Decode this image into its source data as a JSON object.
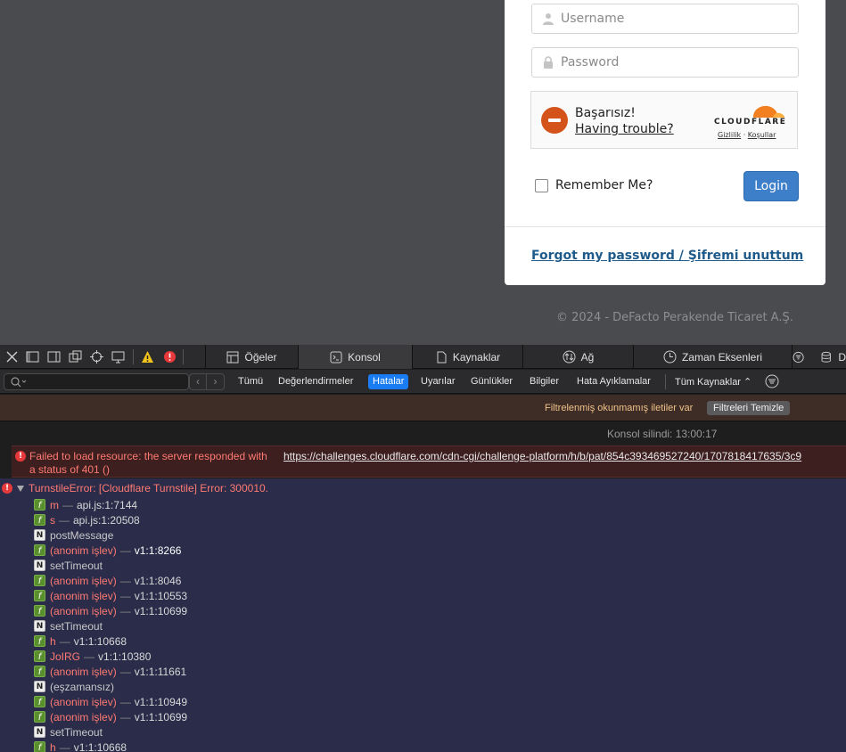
{
  "login": {
    "username_placeholder": "Username",
    "password_placeholder": "Password",
    "turnstile": {
      "status": "Başarısız!",
      "help": "Having trouble?",
      "brand": "CLOUDFLARE",
      "privacy": "Gizlilik",
      "dot": "·",
      "terms": "Koşullar"
    },
    "remember_label": "Remember Me?",
    "login_button": "Login",
    "forgot_link": "Forgot my password / Şifremi unuttum"
  },
  "footer": {
    "copyright": "© 2024 - DeFacto Perakende Ticaret A.Ş."
  },
  "devtools": {
    "tabs": [
      {
        "label": "Öğeler",
        "icon": "elements-icon"
      },
      {
        "label": "Konsol",
        "icon": "console-icon"
      },
      {
        "label": "Kaynaklar",
        "icon": "sources-icon"
      },
      {
        "label": "Ağ",
        "icon": "network-icon"
      },
      {
        "label": "Zaman Eksenleri",
        "icon": "timelines-icon"
      },
      {
        "label": "D",
        "icon": "storage-icon"
      }
    ],
    "active_tab": "Konsol",
    "filters": [
      "Tümü",
      "Değerlendirmeler",
      "Hatalar",
      "Uyarılar",
      "Günlükler",
      "Bilgiler",
      "Hata Ayıklamalar"
    ],
    "active_filter": "Hatalar",
    "sources_select": "Tüm Kaynaklar",
    "notice_text": "Filtrelenmiş okunmamış iletiler var",
    "notice_button": "Filtreleri Temizle",
    "cleared_text": "Konsol silindi: 13:00:17",
    "error1": {
      "message_line1": "Failed to load resource: the server responded with",
      "message_line2": "a status of 401 ()",
      "url": "https://challenges.cloudflare.com/cdn-cgi/challenge-platform/h/b/pat/854c393469527240/1707818417635/3c9"
    },
    "error2": {
      "title": "TurnstileError: [Cloudflare Turnstile] Error: 300010.",
      "frames": [
        {
          "type": "f",
          "name": "m",
          "sep": "—",
          "loc": "api.js:1:7144"
        },
        {
          "type": "f",
          "name": "s",
          "sep": "—",
          "loc": "api.js:1:20508"
        },
        {
          "type": "N",
          "name": "postMessage",
          "sep": "",
          "loc": ""
        },
        {
          "type": "f",
          "name": "(anonim işlev)",
          "sep": "—",
          "loc": "v1:1:8266"
        },
        {
          "type": "N",
          "name": "setTimeout",
          "sep": "",
          "loc": ""
        },
        {
          "type": "f",
          "name": "(anonim işlev)",
          "sep": "—",
          "loc": "v1:1:8046"
        },
        {
          "type": "f",
          "name": "(anonim işlev)",
          "sep": "—",
          "loc": "v1:1:10553"
        },
        {
          "type": "f",
          "name": "(anonim işlev)",
          "sep": "—",
          "loc": "v1:1:10699"
        },
        {
          "type": "N",
          "name": "setTimeout",
          "sep": "",
          "loc": ""
        },
        {
          "type": "f",
          "name": "h",
          "sep": "—",
          "loc": "v1:1:10668"
        },
        {
          "type": "f",
          "name": "JoIRG",
          "sep": "—",
          "loc": "v1:1:10380"
        },
        {
          "type": "f",
          "name": "(anonim işlev)",
          "sep": "—",
          "loc": "v1:1:11661"
        },
        {
          "type": "N",
          "name": "(eşzamansız)",
          "sep": "",
          "loc": ""
        },
        {
          "type": "f",
          "name": "(anonim işlev)",
          "sep": "—",
          "loc": "v1:1:10949"
        },
        {
          "type": "f",
          "name": "(anonim işlev)",
          "sep": "—",
          "loc": "v1:1:10699"
        },
        {
          "type": "N",
          "name": "setTimeout",
          "sep": "",
          "loc": ""
        },
        {
          "type": "f",
          "name": "h",
          "sep": "—",
          "loc": "v1:1:10668"
        }
      ]
    }
  },
  "colors": {
    "page_bg": "#4a4b4e",
    "login_blue": "#3d7fc8",
    "link_blue": "#1f5b8a",
    "cloudflare_orange": "#f38020",
    "error_red": "#ff7a72",
    "active_filter": "#1a7cf2"
  }
}
